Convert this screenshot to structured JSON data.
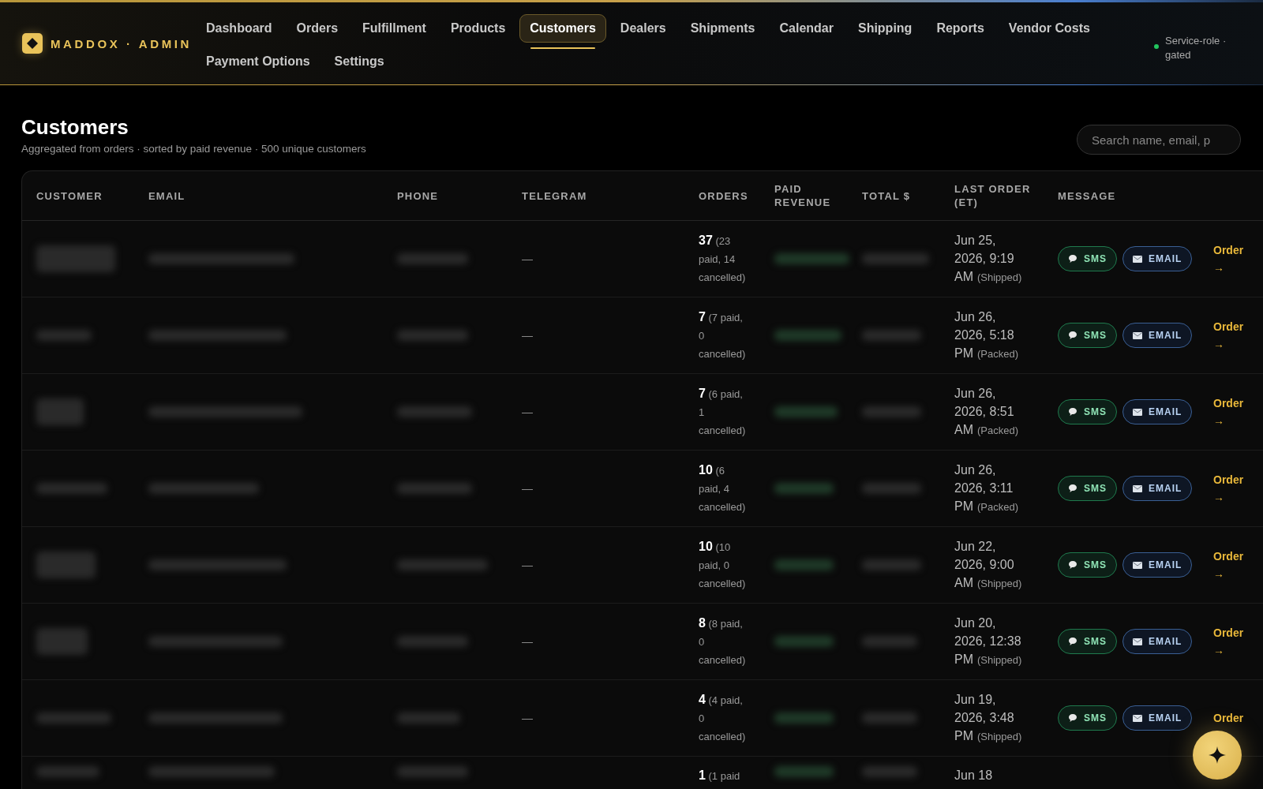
{
  "brand": {
    "name": "MADDOX · ADMIN"
  },
  "nav": [
    {
      "label": "Dashboard",
      "selected": false
    },
    {
      "label": "Orders",
      "selected": false
    },
    {
      "label": "Fulfillment",
      "selected": false
    },
    {
      "label": "Products",
      "selected": false
    },
    {
      "label": "Customers",
      "selected": true
    },
    {
      "label": "Dealers",
      "selected": false
    },
    {
      "label": "Shipments",
      "selected": false
    },
    {
      "label": "Calendar",
      "selected": false
    },
    {
      "label": "Shipping",
      "selected": false
    },
    {
      "label": "Reports",
      "selected": false
    },
    {
      "label": "Vendor Costs",
      "selected": false
    },
    {
      "label": "Payment Options",
      "selected": false
    },
    {
      "label": "Settings",
      "selected": false
    }
  ],
  "status": {
    "text": "Service-role · gated",
    "color": "#22c55e"
  },
  "page": {
    "title": "Customers",
    "subtitle": "Aggregated from orders · sorted by paid revenue · 500 unique customers"
  },
  "search": {
    "placeholder": "Search name, email, p"
  },
  "table": {
    "columns": [
      "CUSTOMER",
      "EMAIL",
      "PHONE",
      "TELEGRAM",
      "ORDERS",
      "PAID REVENUE",
      "TOTAL $",
      "LAST ORDER (ET)",
      "MESSAGE"
    ],
    "rows": [
      {
        "telegram": "—",
        "orders": "37",
        "orders_detail": "(23 paid, 14 cancelled)",
        "last_order": "Jun 25, 2026, 9:19 AM",
        "status": "(Shipped)",
        "sms": "SMS",
        "email_button": "EMAIL",
        "link": "Order",
        "link_arrow": "→"
      },
      {
        "telegram": "—",
        "orders": "7",
        "orders_detail": "(7 paid, 0 cancelled)",
        "last_order": "Jun 26, 2026, 5:18 PM",
        "status": "(Packed)",
        "sms": "SMS",
        "email_button": "EMAIL",
        "link": "Order",
        "link_arrow": "→"
      },
      {
        "telegram": "—",
        "orders": "7",
        "orders_detail": "(6 paid, 1 cancelled)",
        "last_order": "Jun 26, 2026, 8:51 AM",
        "status": "(Packed)",
        "sms": "SMS",
        "email_button": "EMAIL",
        "link": "Order",
        "link_arrow": "→"
      },
      {
        "telegram": "—",
        "orders": "10",
        "orders_detail": "(6 paid, 4 cancelled)",
        "last_order": "Jun 26, 2026, 3:11 PM",
        "status": "(Packed)",
        "sms": "SMS",
        "email_button": "EMAIL",
        "link": "Order",
        "link_arrow": "→"
      },
      {
        "telegram": "—",
        "orders": "10",
        "orders_detail": "(10 paid, 0 cancelled)",
        "last_order": "Jun 22, 2026, 9:00 AM",
        "status": "(Shipped)",
        "sms": "SMS",
        "email_button": "EMAIL",
        "link": "Order",
        "link_arrow": "→"
      },
      {
        "telegram": "—",
        "orders": "8",
        "orders_detail": "(8 paid, 0 cancelled)",
        "last_order": "Jun 20, 2026, 12:38 PM",
        "status": "(Shipped)",
        "sms": "SMS",
        "email_button": "EMAIL",
        "link": "Order",
        "link_arrow": "→"
      },
      {
        "telegram": "—",
        "orders": "4",
        "orders_detail": "(4 paid, 0 cancelled)",
        "last_order": "Jun 19, 2026, 3:48 PM",
        "status": "(Shipped)",
        "sms": "SMS",
        "email_button": "EMAIL",
        "link": "Order"
      },
      {
        "orders": "1",
        "orders_detail": "(1 paid",
        "last_order": "Jun 18"
      }
    ]
  }
}
